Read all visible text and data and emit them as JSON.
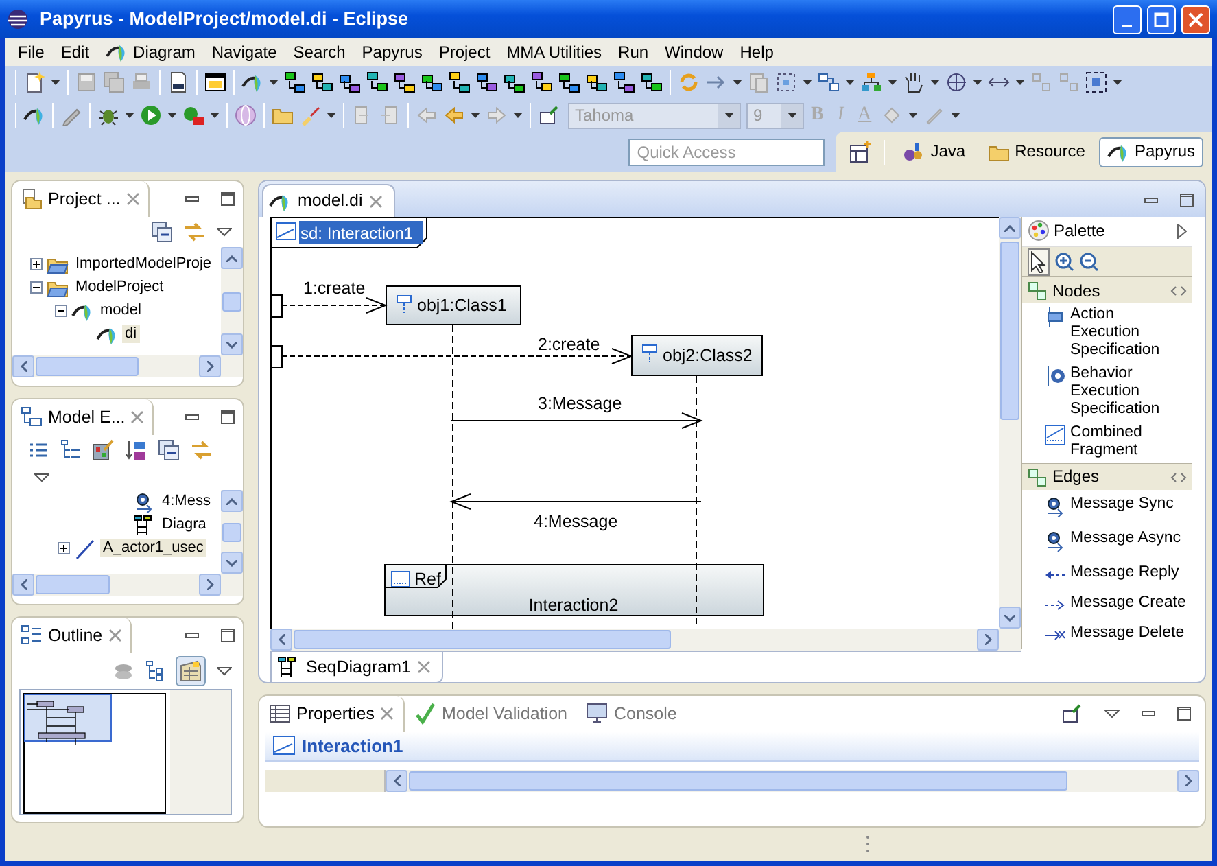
{
  "window": {
    "title": "Papyrus - ModelProject/model.di - Eclipse"
  },
  "menu": [
    {
      "label": "File",
      "kind": "plain"
    },
    {
      "label": "Edit",
      "kind": "plain"
    },
    {
      "label": "Diagram",
      "kind": "papyrus"
    },
    {
      "label": "Navigate",
      "kind": "plain"
    },
    {
      "label": "Search",
      "kind": "plain"
    },
    {
      "label": "Papyrus",
      "kind": "plain"
    },
    {
      "label": "Project",
      "kind": "plain"
    },
    {
      "label": "MMA Utilities",
      "kind": "plain"
    },
    {
      "label": "Run",
      "kind": "plain"
    },
    {
      "label": "Window",
      "kind": "plain"
    },
    {
      "label": "Help",
      "kind": "plain"
    }
  ],
  "toolbar": {
    "font": {
      "value": "Tahoma",
      "disabled": true
    },
    "size": {
      "value": "9",
      "disabled": true
    },
    "format_buttons": [
      {
        "label": "B",
        "kind": "bold",
        "disabled": true
      },
      {
        "label": "I",
        "kind": "italic",
        "disabled": true
      },
      {
        "label": "A",
        "kind": "color",
        "disabled": true
      }
    ]
  },
  "quick_access": {
    "placeholder": "Quick Access"
  },
  "perspectives": [
    {
      "label": "Java",
      "kind": "java",
      "selected": false
    },
    {
      "label": "Resource",
      "kind": "resource",
      "selected": false
    },
    {
      "label": "Papyrus",
      "kind": "papyrus",
      "selected": true
    }
  ],
  "project_explorer": {
    "title": "Project ...",
    "tree": [
      {
        "label": "ImportedModelProje",
        "kind": "project",
        "expanded": false,
        "selected": false
      },
      {
        "label": "ModelProject",
        "kind": "project",
        "expanded": true,
        "selected": false,
        "children": [
          {
            "label": "model",
            "kind": "model",
            "expanded": true,
            "selected": false,
            "children": [
              {
                "label": "di",
                "kind": "model",
                "selected": true
              }
            ]
          }
        ]
      }
    ]
  },
  "model_explorer": {
    "title": "Model E...",
    "tree": [
      {
        "label": "4:Mess",
        "kind": "message",
        "selected": false
      },
      {
        "label": "Diagra",
        "kind": "diagram",
        "selected": false
      },
      {
        "label": "A_actor1_usec",
        "kind": "association",
        "expanded": false,
        "selected": true
      }
    ]
  },
  "outline": {
    "title": "Outline"
  },
  "editor": {
    "tab": "model.di",
    "frame": {
      "label": "sd: Interaction1",
      "selected": true
    },
    "lifelines": [
      {
        "label": "obj1:Class1"
      },
      {
        "label": "obj2:Class2"
      }
    ],
    "messages": [
      {
        "label": "1:create",
        "kind": "create"
      },
      {
        "label": "2:create",
        "kind": "create"
      },
      {
        "label": "3:Message",
        "kind": "sync"
      },
      {
        "label": "4:Message",
        "kind": "sync"
      }
    ],
    "ref": {
      "tag": "Ref",
      "label": "Interaction2"
    },
    "bottom_tab": "SeqDiagram1"
  },
  "palette": {
    "title": "Palette",
    "drawers": [
      {
        "label": "Nodes",
        "tools": [
          {
            "label": "Action Execution Specification",
            "kind": "action"
          },
          {
            "label": "Behavior Execution Specification",
            "kind": "behavior"
          },
          {
            "label": "Combined Fragment",
            "kind": "fragment"
          }
        ]
      },
      {
        "label": "Edges",
        "tools": [
          {
            "label": "Message Sync",
            "kind": "sync"
          },
          {
            "label": "Message Async",
            "kind": "async"
          },
          {
            "label": "Message Reply",
            "kind": "reply"
          },
          {
            "label": "Message Create",
            "kind": "create"
          },
          {
            "label": "Message Delete",
            "kind": "delete"
          }
        ]
      }
    ]
  },
  "bottom_panel": {
    "tabs": [
      {
        "label": "Properties",
        "kind": "properties",
        "selected": true
      },
      {
        "label": "Model Validation",
        "kind": "validation",
        "selected": false
      },
      {
        "label": "Console",
        "kind": "console",
        "selected": false
      }
    ],
    "title": "Interaction1"
  }
}
